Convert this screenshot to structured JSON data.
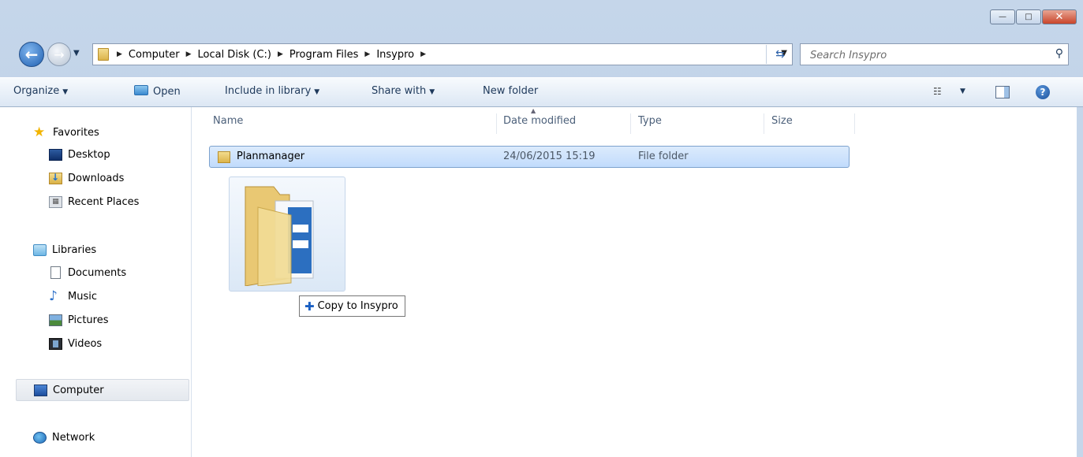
{
  "window": {
    "minimize_glyph": "—",
    "maximize_glyph": "□",
    "close_glyph": "✕"
  },
  "navigation": {
    "back_icon": "back-arrow-icon",
    "forward_icon": "forward-arrow-icon",
    "breadcrumbs": [
      "Computer",
      "Local Disk (C:)",
      "Program Files",
      "Insypro"
    ]
  },
  "search": {
    "placeholder": "Search Insypro"
  },
  "toolbar": {
    "organize_label": "Organize",
    "open_label": "Open",
    "include_label": "Include in library",
    "share_label": "Share with",
    "new_folder_label": "New folder"
  },
  "sidebar": {
    "favorites_label": "Favorites",
    "favorites": [
      {
        "label": "Desktop",
        "icon": "desktop-icon"
      },
      {
        "label": "Downloads",
        "icon": "downloads-icon"
      },
      {
        "label": "Recent Places",
        "icon": "recent-places-icon"
      }
    ],
    "libraries_label": "Libraries",
    "libraries": [
      {
        "label": "Documents",
        "icon": "documents-icon"
      },
      {
        "label": "Music",
        "icon": "music-icon"
      },
      {
        "label": "Pictures",
        "icon": "pictures-icon"
      },
      {
        "label": "Videos",
        "icon": "videos-icon"
      }
    ],
    "computer_label": "Computer",
    "network_label": "Network"
  },
  "file_list": {
    "columns": [
      "Name",
      "Date modified",
      "Type",
      "Size"
    ],
    "rows": [
      {
        "name": "Planmanager",
        "date_modified": "24/06/2015 15:19",
        "type": "File folder",
        "size": ""
      }
    ]
  },
  "drag": {
    "tooltip": "Copy to Insypro"
  },
  "colors": {
    "frame": "#b9cde4",
    "selection": "#c1dbfc",
    "accent": "#1e395b"
  }
}
